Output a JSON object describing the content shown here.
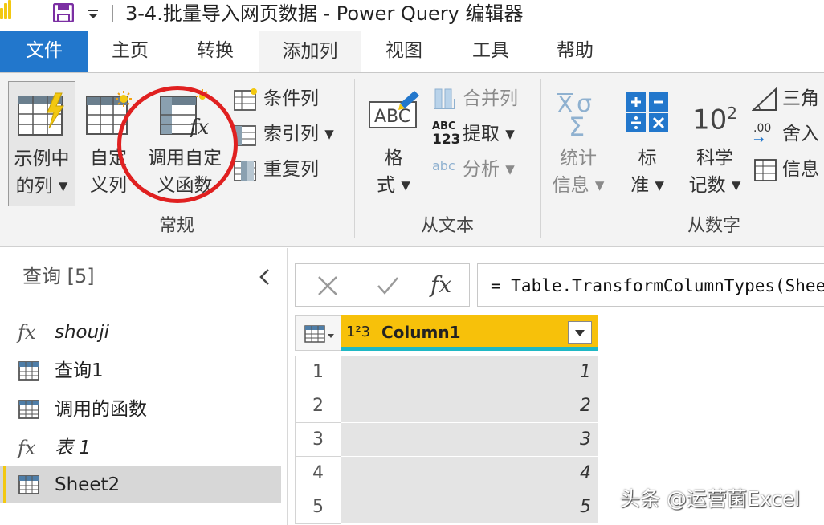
{
  "window": {
    "title": "3-4.批量导入网页数据 - Power Query 编辑器"
  },
  "tabs": [
    "文件",
    "主页",
    "转换",
    "添加列",
    "视图",
    "工具",
    "帮助"
  ],
  "ribbon": {
    "general": {
      "group_label": "常规",
      "example_col": [
        "示例中",
        "的列 ▾"
      ],
      "custom_col": [
        "自定",
        "义列"
      ],
      "invoke_func": [
        "调用自定",
        "义函数"
      ],
      "conditional_col": "条件列",
      "index_col": "索引列 ▾",
      "duplicate_col": "重复列"
    },
    "from_text": {
      "group_label": "从文本",
      "format": [
        "格",
        "式 ▾"
      ],
      "merge_cols": "合并列",
      "extract": "提取 ▾",
      "parse": "分析 ▾"
    },
    "from_number": {
      "group_label": "从数字",
      "statistics": [
        "统计",
        "信息 ▾"
      ],
      "standard": [
        "标",
        "准 ▾"
      ],
      "scientific": [
        "科学",
        "记数 ▾"
      ],
      "trig": "三角",
      "rounding": "舍入",
      "info": "信息",
      "scientific_icon_text": "10",
      "scientific_icon_exp": "2",
      "abc_icon_text": "ABC",
      "abc123_top": "ABC",
      "abc123_bottom": "123",
      "parse_icon_text": "abc",
      "rounding_icon_text": ".00"
    }
  },
  "queries": {
    "header": "查询 [5]",
    "items": [
      {
        "label": "shouji",
        "type": "function"
      },
      {
        "label": "查询1",
        "type": "table"
      },
      {
        "label": "调用的函数",
        "type": "table"
      },
      {
        "label": "表 1",
        "type": "function"
      },
      {
        "label": "Sheet2",
        "type": "table",
        "selected": true
      }
    ]
  },
  "formula_bar": {
    "fx_label": "fx",
    "formula": "= Table.TransformColumnTypes(Sheet"
  },
  "grid": {
    "column": {
      "type_label": "1²3",
      "name": "Column1"
    },
    "rows": [
      {
        "row": "1",
        "value": "1"
      },
      {
        "row": "2",
        "value": "2"
      },
      {
        "row": "3",
        "value": "3"
      },
      {
        "row": "4",
        "value": "4"
      },
      {
        "row": "5",
        "value": "5"
      }
    ]
  },
  "watermark": "头条 @运营菌Excel",
  "colors": {
    "accent_yellow": "#f2c811",
    "file_tab": "#2277cc",
    "highlight_circle": "#e02020",
    "column_header": "#f7c10a",
    "column_quality": "#1fb8c4"
  }
}
